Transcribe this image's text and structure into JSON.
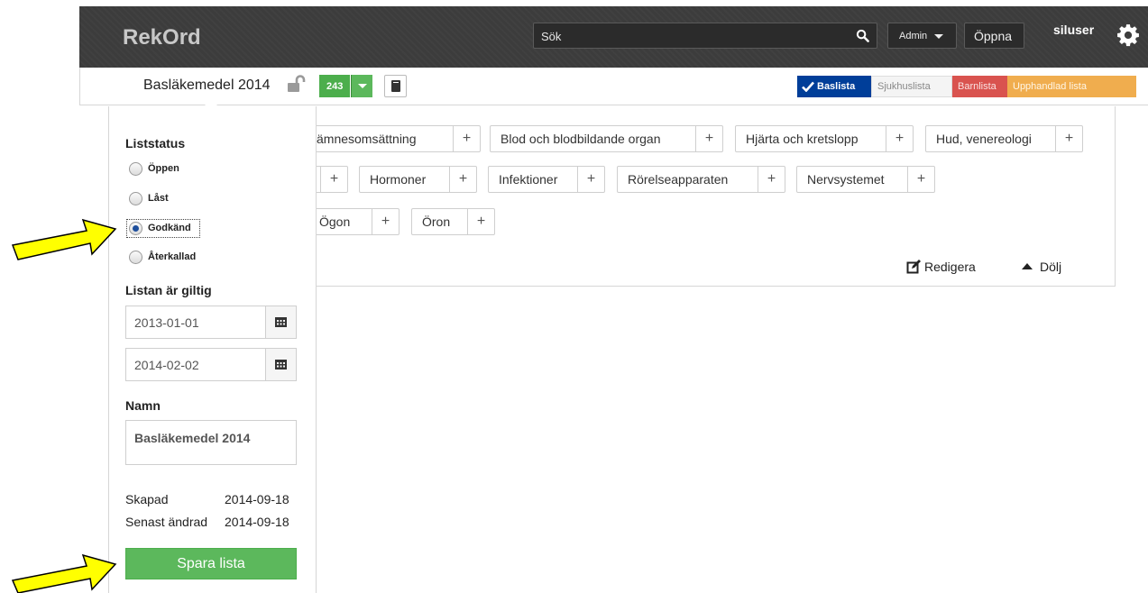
{
  "navbar": {
    "brand": "RekOrd",
    "search_placeholder": "Sök",
    "admin_label": "Admin",
    "open_label": "Öppna",
    "username": "siluser"
  },
  "subbar": {
    "list_title": "Basläkemedel 2014",
    "count": "243",
    "tags": [
      "Baslista",
      "Sjukhuslista",
      "Barnlista",
      "Upphandlad lista"
    ]
  },
  "categories": [
    "ämnesomsättning",
    "Blod och blodbildande organ",
    "Hjärta och kretslopp",
    "Hud, venereologi",
    "Hormoner",
    "Infektioner",
    "Rörelseapparaten",
    "Nervsystemet",
    "Ögon",
    "Öron"
  ],
  "panel_actions": {
    "edit": "Redigera",
    "hide": "Dölj"
  },
  "popup": {
    "status_header": "Liststatus",
    "statuses": [
      "Öppen",
      "Låst",
      "Godkänd",
      "Återkallad"
    ],
    "selected_status": "Godkänd",
    "valid_header": "Listan är giltig",
    "valid_from": "2013-01-01",
    "valid_to": "2014-02-02",
    "name_header": "Namn",
    "name_value": "Basläkemedel 2014",
    "created_label": "Skapad",
    "created_value": "2014-09-18",
    "modified_label": "Senast ändrad",
    "modified_value": "2014-09-18",
    "save_label": "Spara lista"
  },
  "colors": {
    "navbar": "#3c3c3c",
    "green": "#5cb85c",
    "blue_tag": "#003e99",
    "red_tag": "#d9534f",
    "orange_tag": "#f0ad4e",
    "arrow": "#ffff00"
  }
}
